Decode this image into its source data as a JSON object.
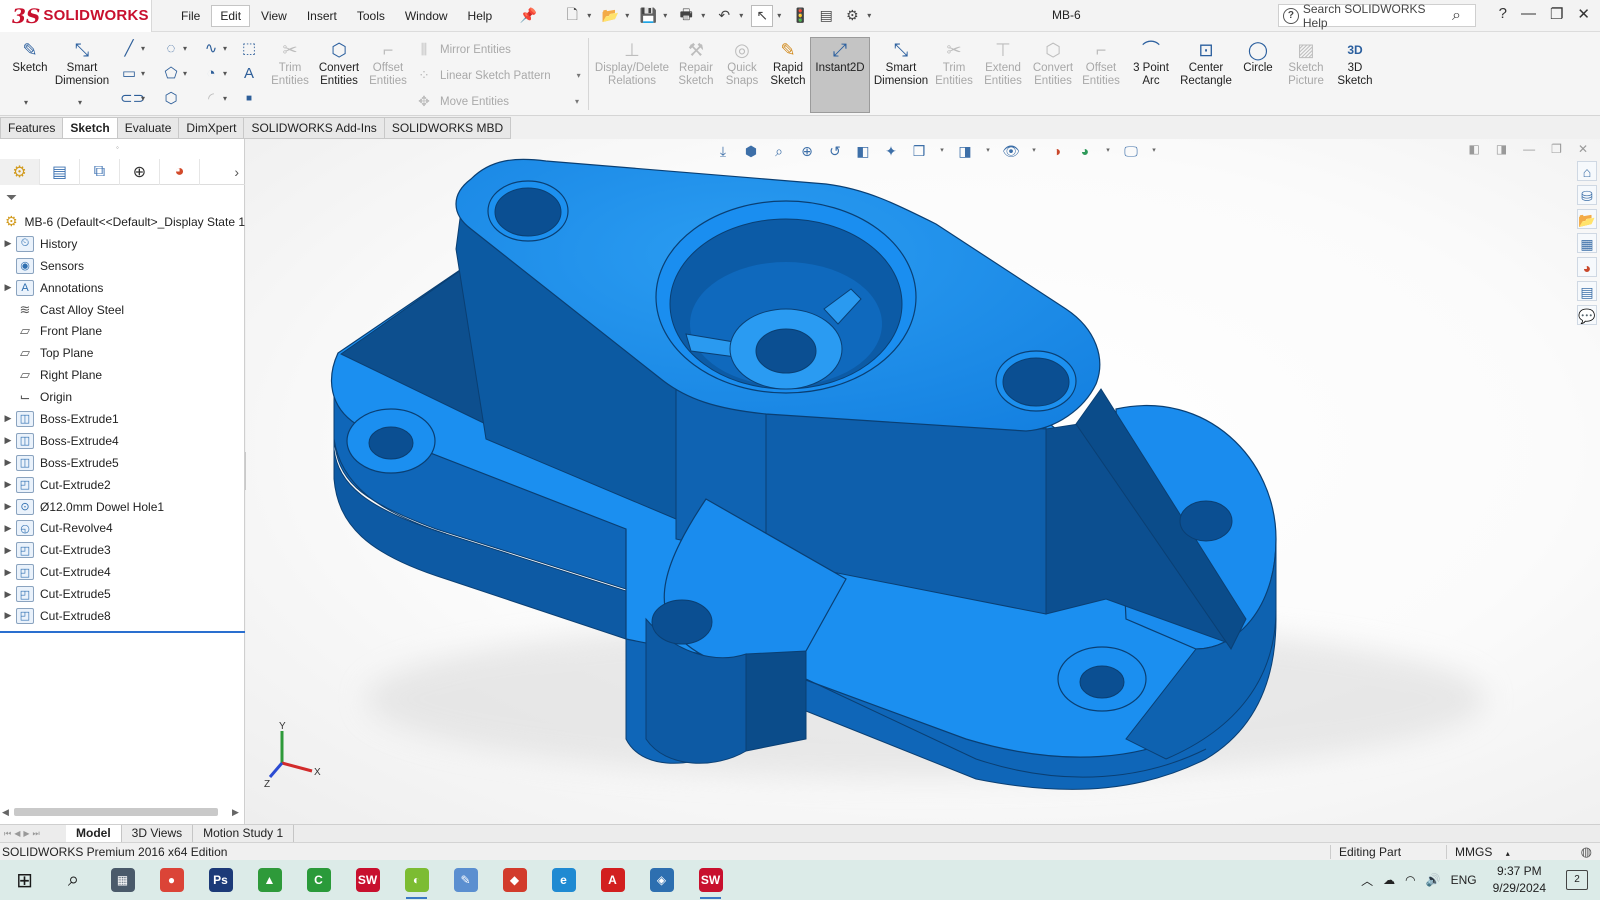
{
  "app": {
    "brand": "SOLIDWORKS",
    "ds_mark": "3S",
    "document_title": "MB-6",
    "menus": [
      "File",
      "Edit",
      "View",
      "Insert",
      "Tools",
      "Window",
      "Help"
    ],
    "active_menu": "Edit",
    "help_search_placeholder": "Search SOLIDWORKS Help"
  },
  "command_manager": {
    "sketch": "Sketch",
    "smart_dimension": "Smart Dimension",
    "trim_entities": "Trim Entities",
    "convert_entities": "Convert Entities",
    "offset_entities": "Offset Entities",
    "mirror_entities": "Mirror Entities",
    "linear_sketch_pattern": "Linear Sketch Pattern",
    "move_entities": "Move Entities",
    "display_delete_relations": "Display/Delete Relations",
    "repair_sketch": "Repair Sketch",
    "quick_snaps": "Quick Snaps",
    "rapid_sketch": "Rapid Sketch",
    "instant2d": "Instant2D",
    "smart_dimension_2": "Smart Dimension",
    "trim_entities_2": "Trim Entities",
    "extend_entities": "Extend Entities",
    "convert_entities_2": "Convert Entities",
    "offset_entities_2": "Offset Entities",
    "three_point_arc": "3 Point Arc",
    "center_rectangle": "Center Rectangle",
    "circle": "Circle",
    "sketch_picture": "Sketch Picture",
    "three_d_sketch": "3D Sketch"
  },
  "tabs": [
    "Features",
    "Sketch",
    "Evaluate",
    "DimXpert",
    "SOLIDWORKS Add-Ins",
    "SOLIDWORKS MBD"
  ],
  "active_tab": "Sketch",
  "feature_tree": {
    "root": "MB-6  (Default<<Default>_Display State 1",
    "items": [
      {
        "label": "History",
        "icon": "history-icon",
        "expandable": true
      },
      {
        "label": "Sensors",
        "icon": "sensors-icon",
        "expandable": false
      },
      {
        "label": "Annotations",
        "icon": "annotations-icon",
        "expandable": true
      },
      {
        "label": "Cast Alloy Steel",
        "icon": "material-icon",
        "expandable": false
      },
      {
        "label": "Front Plane",
        "icon": "plane-icon",
        "expandable": false
      },
      {
        "label": "Top Plane",
        "icon": "plane-icon",
        "expandable": false
      },
      {
        "label": "Right Plane",
        "icon": "plane-icon",
        "expandable": false
      },
      {
        "label": "Origin",
        "icon": "origin-icon",
        "expandable": false
      },
      {
        "label": "Boss-Extrude1",
        "icon": "boss-extrude-icon",
        "expandable": true
      },
      {
        "label": "Boss-Extrude4",
        "icon": "boss-extrude-icon",
        "expandable": true
      },
      {
        "label": "Boss-Extrude5",
        "icon": "boss-extrude-icon",
        "expandable": true
      },
      {
        "label": "Cut-Extrude2",
        "icon": "cut-extrude-icon",
        "expandable": true
      },
      {
        "label": "Ø12.0mm Dowel Hole1",
        "icon": "hole-wizard-icon",
        "expandable": true
      },
      {
        "label": "Cut-Revolve4",
        "icon": "cut-revolve-icon",
        "expandable": true
      },
      {
        "label": "Cut-Extrude3",
        "icon": "cut-extrude-icon",
        "expandable": true
      },
      {
        "label": "Cut-Extrude4",
        "icon": "cut-extrude-icon",
        "expandable": true
      },
      {
        "label": "Cut-Extrude5",
        "icon": "cut-extrude-icon",
        "expandable": true
      },
      {
        "label": "Cut-Extrude8",
        "icon": "cut-extrude-icon",
        "expandable": true
      }
    ]
  },
  "triad": {
    "y": "Y",
    "x": "X",
    "z": "Z"
  },
  "model_tabs": [
    "Model",
    "3D Views",
    "Motion Study 1"
  ],
  "active_model_tab": "Model",
  "status": {
    "edition": "SOLIDWORKS Premium 2016 x64 Edition",
    "mode": "Editing Part",
    "units": "MMGS"
  },
  "taskbar": {
    "apps": [
      {
        "name": "start-button",
        "glyph": "⊞",
        "color": "#1a1a1a"
      },
      {
        "name": "search-button",
        "glyph": "⌕",
        "color": "#1a1a1a"
      },
      {
        "name": "calculator-app",
        "glyph": "▦",
        "color": "#4a5a6a"
      },
      {
        "name": "chrome-app",
        "glyph": "●",
        "color": "#db4437"
      },
      {
        "name": "photoshop-app",
        "glyph": "Ps",
        "color": "#1c3a78"
      },
      {
        "name": "triangle-app",
        "glyph": "▲",
        "color": "#2e9a3a"
      },
      {
        "name": "camtasia-app",
        "glyph": "C",
        "color": "#2a9a3a"
      },
      {
        "name": "solidworks-2016-app",
        "glyph": "SW",
        "color": "#c8102e"
      },
      {
        "name": "green-app",
        "glyph": "◐",
        "color": "#7cbc32"
      },
      {
        "name": "paint-app",
        "glyph": "✎",
        "color": "#5b8fd0"
      },
      {
        "name": "red-app",
        "glyph": "◆",
        "color": "#d23b2b"
      },
      {
        "name": "edge-app",
        "glyph": "e",
        "color": "#1f8ad2"
      },
      {
        "name": "acrobat-app",
        "glyph": "A",
        "color": "#d21f1f"
      },
      {
        "name": "blue-cube-app",
        "glyph": "◈",
        "color": "#2d6fb0"
      },
      {
        "name": "solidworks-app-running",
        "glyph": "SW",
        "color": "#c8102e"
      }
    ],
    "language": "ENG",
    "time": "9:37 PM",
    "date": "9/29/2024",
    "notifications": "2"
  },
  "colors": {
    "model_blue": "#1c8fe8",
    "model_side": "#0e63b2",
    "model_dark": "#0b4a86",
    "brand_red": "#c8102e"
  }
}
